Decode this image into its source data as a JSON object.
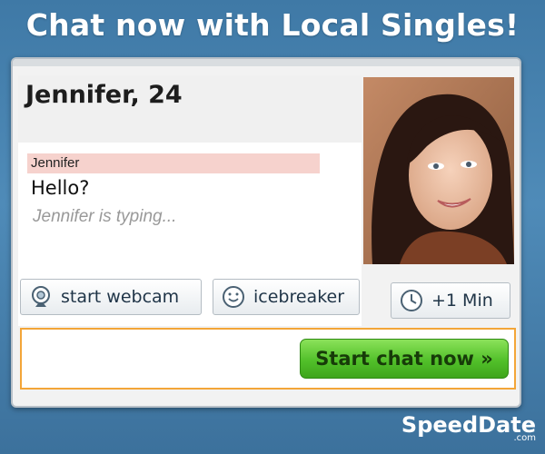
{
  "headline": "Chat now with Local Singles!",
  "profile": {
    "name_age": "Jennifer, 24"
  },
  "chat": {
    "sender": "Jennifer",
    "message": "Hello?",
    "typing_status": "Jennifer is typing..."
  },
  "buttons": {
    "webcam_label": "start webcam",
    "webcam_icon": "webcam-icon",
    "icebreaker_label": "icebreaker",
    "icebreaker_icon": "smiley-icon",
    "add_minute_label": "+1 Min",
    "add_minute_icon": "clock-icon",
    "start_chat_label": "Start chat now »"
  },
  "brand": {
    "name": "SpeedDate",
    "suffix": ".com"
  },
  "colors": {
    "background": "#4a86b4",
    "cta_green": "#52c02a",
    "cta_border_orange": "#f3a538",
    "sender_highlight": "#f6d2cd"
  }
}
